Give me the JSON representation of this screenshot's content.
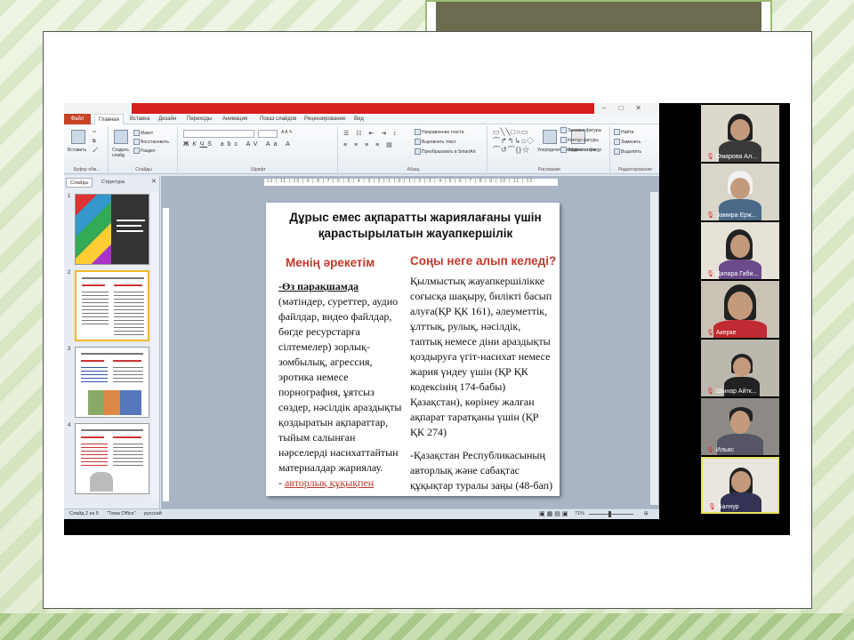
{
  "powerpoint": {
    "menu": {
      "file": "Файл",
      "tabs": [
        "Главная",
        "Вставка",
        "Дизайн",
        "Переходы",
        "Анимация",
        "Показ слайдов",
        "Рецензирование",
        "Вид"
      ]
    },
    "ribbon": {
      "groups": [
        "Буфер обм...",
        "Слайды",
        "Шрифт",
        "Абзац",
        "Рисование",
        "Редактирование"
      ],
      "paste": "Вставить",
      "create_slide": "Создать слайд",
      "layout": "Макет",
      "restore": "Восстановить",
      "section": "Раздел",
      "text_direction": "Направление текста",
      "align_text": "Выровнять текст",
      "convert_smartart": "Преобразовать в SmartArt",
      "arrange": "Упорядочить",
      "quick_styles": "Экспресс-стили",
      "shape_fill": "Заливка фигуры",
      "shape_outline": "Контур фигуры",
      "shape_effects": "Эффекты фигур",
      "find": "Найти",
      "replace": "Заменить",
      "select": "Выделить"
    },
    "left_panel": {
      "tabs": [
        "Слайды",
        "Структура"
      ],
      "thumb_numbers": [
        "1",
        "2",
        "3",
        "4"
      ]
    },
    "slide": {
      "title": "Дұрыс емес ақпаратты жариялағаны үшін қарастырылатын жауапкершілік",
      "left_heading": "Менің әрекетім",
      "left_lead": "-Өз парақшамда",
      "left_body": " (мәтіндер, суреттер, аудио файлдар, видео файлдар, бөгде ресурстарға сілтемелер) зорлық-зомбылық, агрессия, эротика немесе порнография, ұятсыз сөздер, нәсілдік араздықты қоздыратын ақпараттар, тыйым салынған нәрселерді насихаттайтын материалдар жариялау.",
      "left_link_prefix": "- ",
      "left_link": "авторлық құқықпен қорғалатын материалдарды көшіру.",
      "right_heading": "Соңы неге алып келеді?",
      "right_body": "Қылмыстық жауапкершілікке соғысқа шақыру, билікті басып алуға(ҚР ҚК 161), әлеуметтік, ұлттық, рулық, нәсілдік, таптық немесе діни араздықты қоздыруға үгіт-насихат немесе жария үндеу үшін (ҚР ҚК кодексінің 174-бабы) Қазақстан), көрінеу жалған ақпарат таратқаны үшін (ҚР ҚК 274)",
      "right_body2": "-Қазақстан Республикасының авторлық және сабақтас құқықтар туралы заңы (48-бап)"
    },
    "status": {
      "slide_of": "Слайд 2 из 5",
      "theme": "\"Тема Office\"",
      "language": "русский",
      "zoom": "71%"
    }
  },
  "participants": [
    {
      "name": "Омарова Ал...",
      "active": false
    },
    {
      "name": "Замира Ерж...",
      "active": false
    },
    {
      "name": "Дилара Габи...",
      "active": false
    },
    {
      "name": "Акерке",
      "active": false
    },
    {
      "name": "Шынар Айтк...",
      "active": false
    },
    {
      "name": "Ильяс",
      "active": false
    },
    {
      "name": "Балнур",
      "active": true
    }
  ],
  "colors": {
    "file_tab": "#c6442a",
    "heading_red": "#c0392b",
    "titlebar_red": "#d71d1d",
    "frame_green": "#9cbd73",
    "active_tile": "#e8e45c"
  }
}
